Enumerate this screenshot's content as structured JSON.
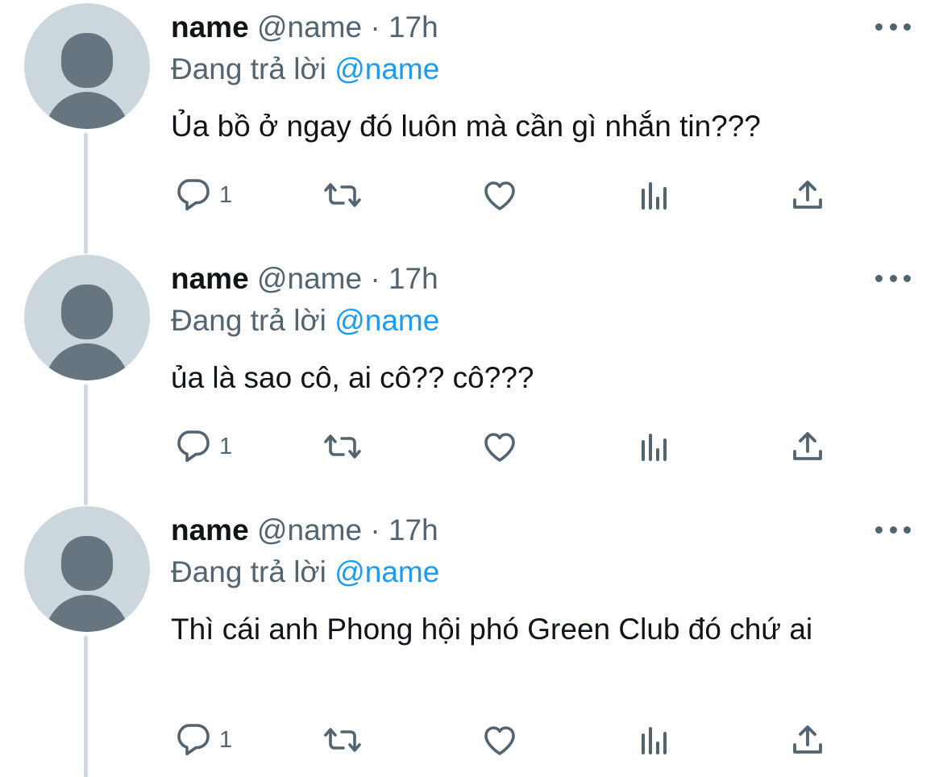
{
  "tweets": [
    {
      "display_name": "name",
      "handle": "@name",
      "separator": "·",
      "time": "17h",
      "replying_prefix": "Đang trả lời",
      "replying_to": "@name",
      "text": "Ủa bồ ở ngay đó luôn mà cần gì nhắn tin???",
      "reply_count": "1"
    },
    {
      "display_name": "name",
      "handle": "@name",
      "separator": "·",
      "time": "17h",
      "replying_prefix": "Đang trả lời",
      "replying_to": "@name",
      "text": "ủa là sao cô, ai cô?? cô???",
      "reply_count": "1"
    },
    {
      "display_name": "name",
      "handle": "@name",
      "separator": "·",
      "time": "17h",
      "replying_prefix": "Đang trả lời",
      "replying_to": "@name",
      "text": "Thì cái anh Phong hội phó Green Club đó chứ ai",
      "reply_count": "1"
    }
  ],
  "icons": {
    "reply": "reply-icon",
    "retweet": "retweet-icon",
    "like": "like-icon",
    "views": "analytics-icon",
    "share": "share-icon",
    "more": "more-icon",
    "avatar": "default-avatar-icon"
  },
  "colors": {
    "text_primary": "#0f1419",
    "text_secondary": "#536471",
    "mention": "#1d9bf0",
    "thread_line": "#cfd9de",
    "avatar_bg": "#ccd6dd",
    "avatar_fg": "#66757f"
  }
}
